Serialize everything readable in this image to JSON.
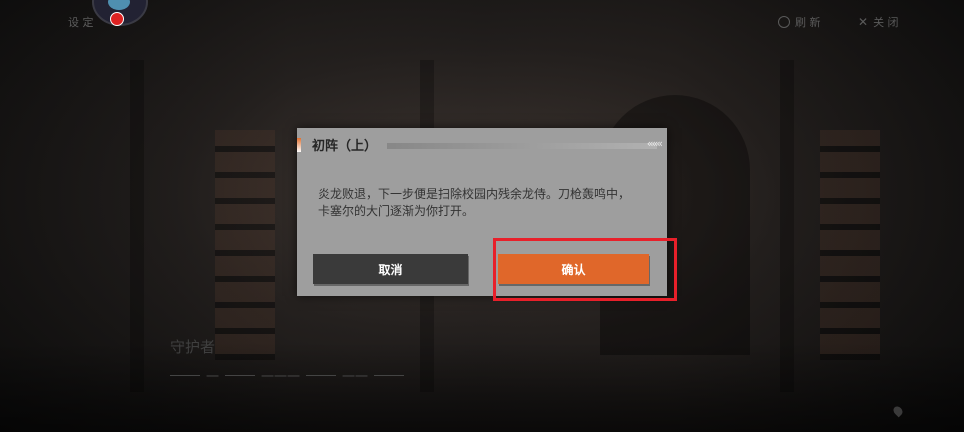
{
  "topbar": {
    "left_label": "设 定",
    "right_1_label": "刷 新",
    "right_2_label": "关 闭",
    "right_1_icon": "refresh-icon",
    "right_2_icon": "close-icon",
    "avatar_icon": "bird-icon",
    "notification_color": "#dd2222"
  },
  "background": {
    "ghost_title": "守护者",
    "ghost_line": [
      "一",
      "一一一",
      "一一"
    ]
  },
  "dialog": {
    "title": "初阵（上）",
    "body_line1": "炎龙败退，下一步便是扫除校园内残余龙侍。刀枪轰鸣中，",
    "body_line2": "卡塞尔的大门逐渐为你打开。",
    "cancel_label": "取消",
    "confirm_label": "确认",
    "confirm_color": "#e0672a",
    "cancel_color": "#3a3a3a"
  },
  "highlight_color": "#e8202a"
}
